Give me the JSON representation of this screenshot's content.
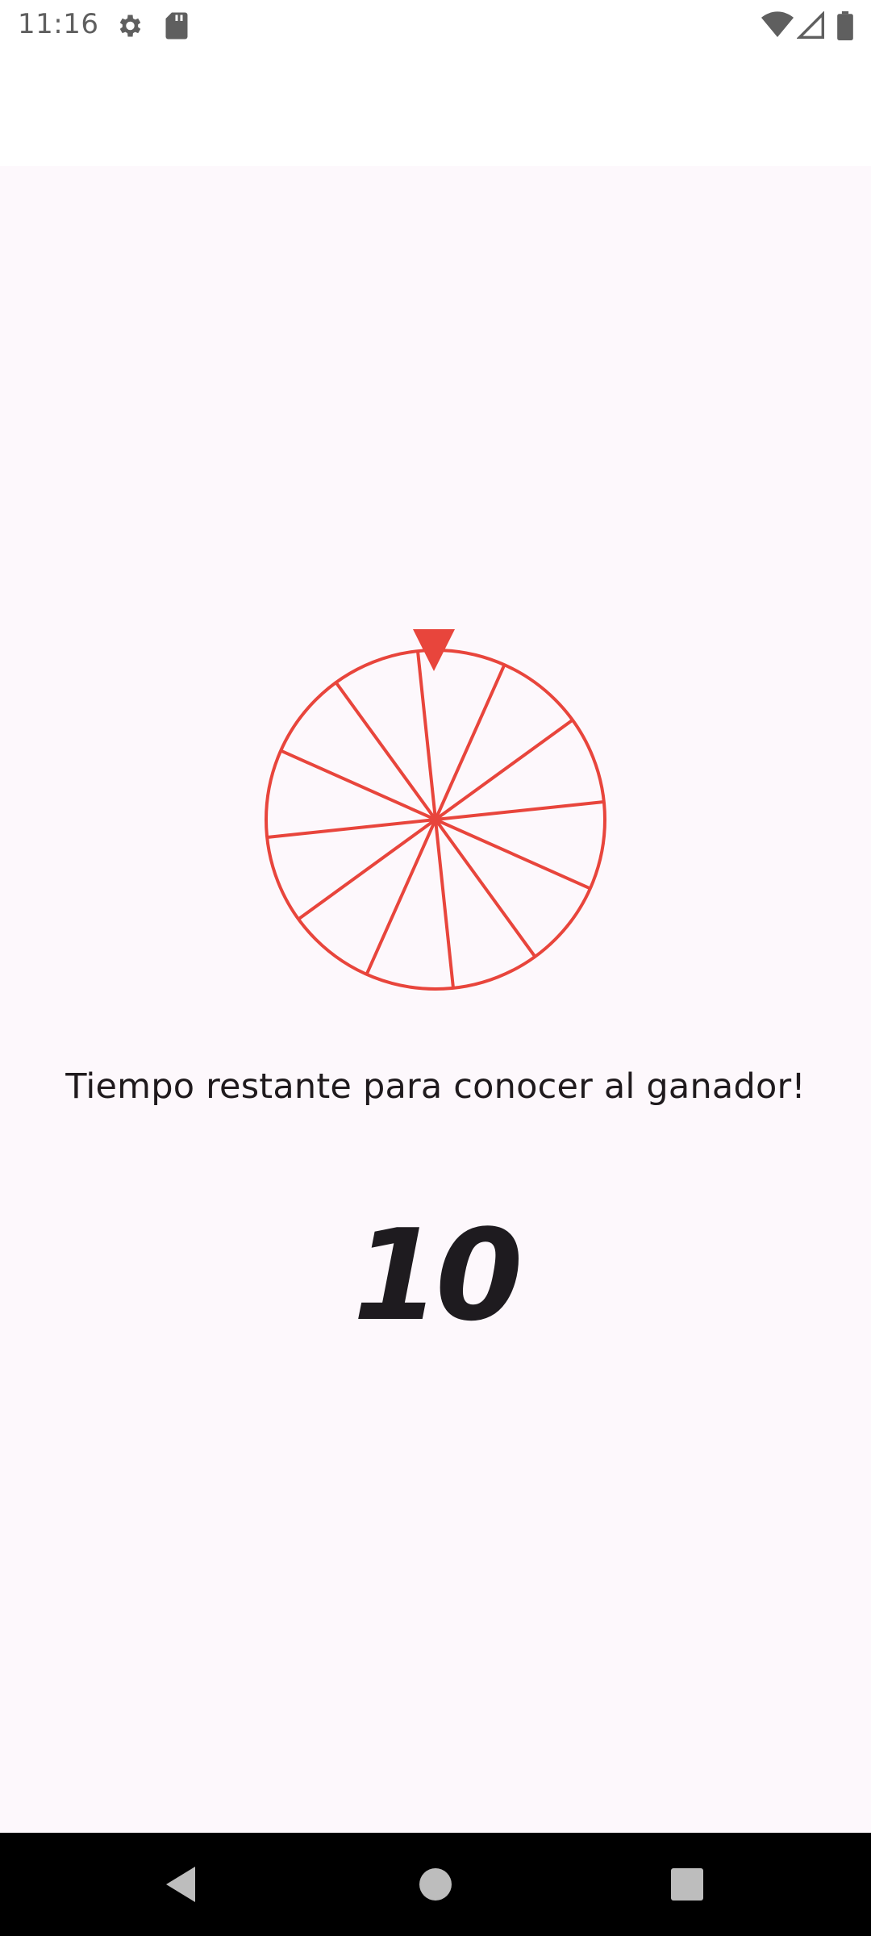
{
  "status_bar": {
    "time": "11:16",
    "left_icons": [
      "gear-icon",
      "sd-card-icon"
    ],
    "right_icons": [
      "wifi-icon",
      "cellular-signal-icon",
      "battery-icon"
    ]
  },
  "wheel": {
    "segments": 12,
    "color": "#e8453c",
    "pointer": "triangle-pointer-down"
  },
  "main": {
    "caption": "Tiempo restante para conocer al ganador!",
    "countdown": "10"
  },
  "nav_bar": {
    "buttons": [
      "back-icon",
      "home-icon",
      "recents-icon"
    ]
  },
  "colors": {
    "accent": "#e8453c",
    "background": "#fdf8fc",
    "text": "#1f1a1d",
    "nav_bar": "#000000"
  }
}
